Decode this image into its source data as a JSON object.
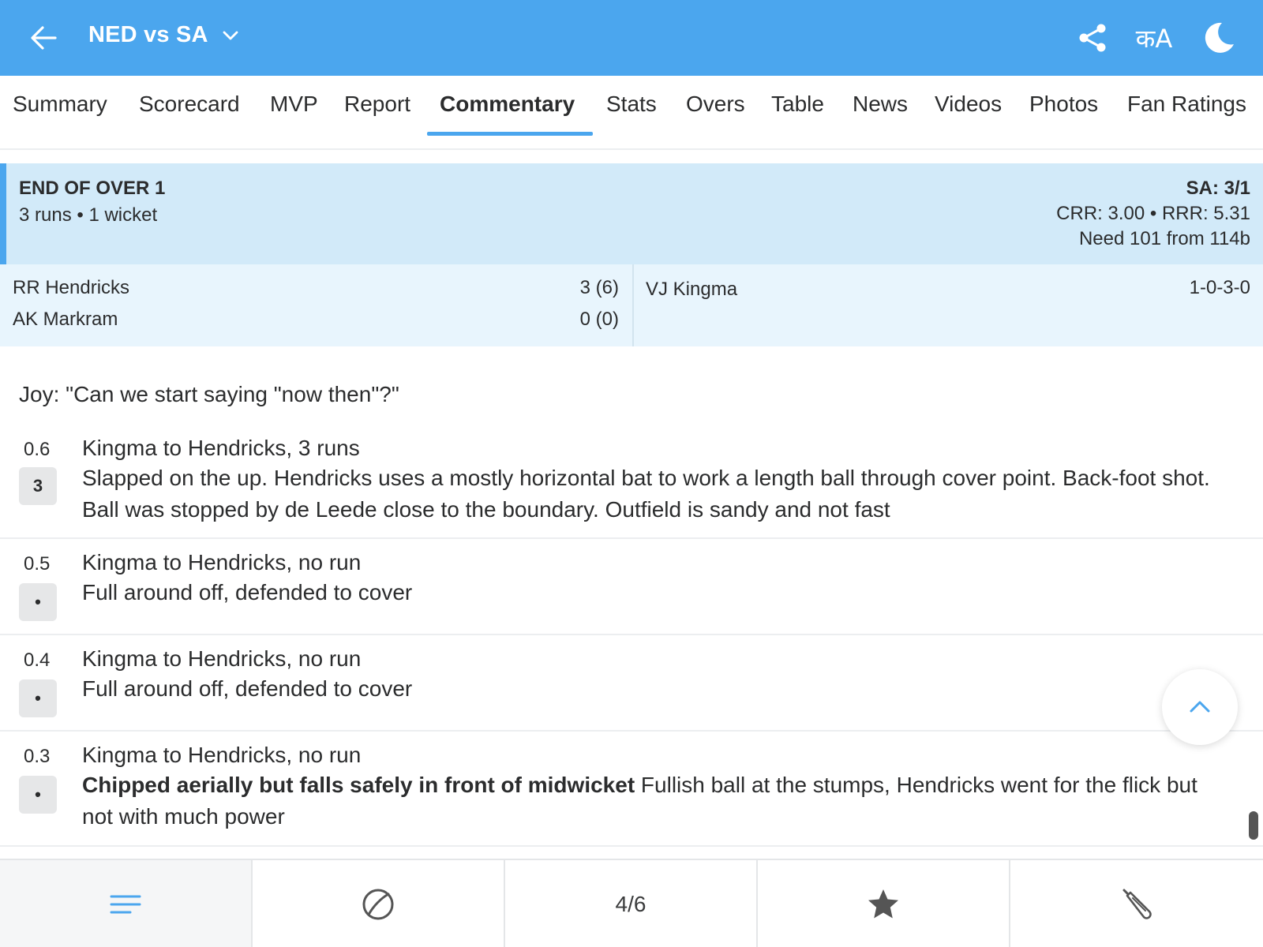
{
  "header": {
    "title": "NED vs SA",
    "back_icon": "arrow-left-icon",
    "lang_label": "कA",
    "colors": {
      "bar": "#4ba6ee",
      "text": "#ffffff"
    }
  },
  "tabs": [
    {
      "label": "Summary"
    },
    {
      "label": "Scorecard"
    },
    {
      "label": "MVP"
    },
    {
      "label": "Report"
    },
    {
      "label": "Commentary",
      "active": true
    },
    {
      "label": "Stats"
    },
    {
      "label": "Overs"
    },
    {
      "label": "Table"
    },
    {
      "label": "News"
    },
    {
      "label": "Videos"
    },
    {
      "label": "Photos"
    },
    {
      "label": "Fan Ratings"
    }
  ],
  "end_of_over": {
    "title": "END OF OVER 1",
    "summary": "3 runs • 1 wicket",
    "score": "SA: 3/1",
    "rates": "CRR: 3.00 • RRR: 5.31",
    "need": "Need 101 from 114b",
    "batters": [
      {
        "name": "RR Hendricks",
        "score": "3 (6)"
      },
      {
        "name": "AK Markram",
        "score": "0 (0)"
      }
    ],
    "bowler": {
      "name": "VJ Kingma",
      "figures": "1-0-3-0"
    }
  },
  "commentary": {
    "note": "Joy: \"Can we start saying \"now then\"?\"",
    "balls": [
      {
        "over": "0.6",
        "result": "3",
        "headline": "Kingma to Hendricks, 3 runs",
        "text": "Slapped on the up. Hendricks uses a mostly horizontal bat to work a length ball through cover point. Back-foot shot. Ball was stopped by de Leede close to the boundary. Outfield is sandy and not fast"
      },
      {
        "over": "0.5",
        "result": "•",
        "headline": "Kingma to Hendricks, no run",
        "text": "Full around off, defended to cover"
      },
      {
        "over": "0.4",
        "result": "•",
        "headline": "Kingma to Hendricks, no run",
        "text": "Full around off, defended to cover"
      },
      {
        "over": "0.3",
        "result": "•",
        "headline": "Kingma to Hendricks, no run",
        "text_bold": "Chipped aerially but falls safely in front of midwicket",
        "text": " Fullish ball at the stumps, Hendricks went for the flick but not with much power"
      }
    ]
  },
  "bottom_nav": {
    "items": [
      {
        "icon": "menu-lines-icon",
        "active": true
      },
      {
        "icon": "cricket-ball-icon"
      },
      {
        "label": "4/6"
      },
      {
        "icon": "star-icon"
      },
      {
        "icon": "cricket-bat-icon"
      }
    ],
    "active_color": "#4ba6ee"
  }
}
